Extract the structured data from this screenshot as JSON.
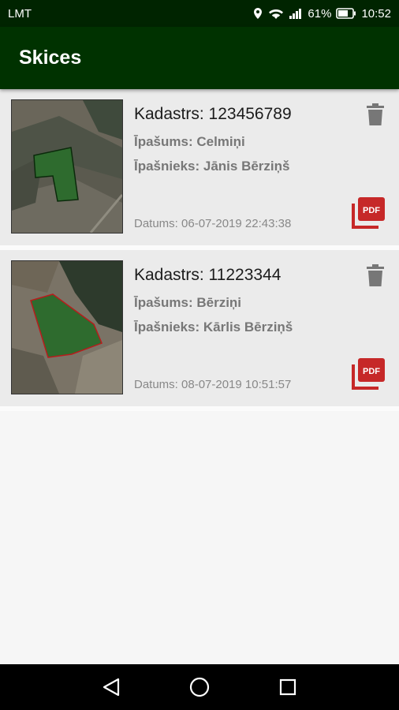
{
  "status_bar": {
    "carrier": "LMT",
    "battery": "61%",
    "time": "10:52"
  },
  "app_bar": {
    "title": "Skices"
  },
  "sketches": [
    {
      "title": "Kadastrs: 123456789",
      "property": "Īpašums: Celmiņi",
      "owner": "Īpašnieks: Jānis Bērziņš",
      "date": "Datums: 06-07-2019 22:43:38"
    },
    {
      "title": "Kadastrs: 11223344",
      "property": "Īpašums: Bērziņi",
      "owner": "Īpašnieks: Kārlis Bērziņš",
      "date": "Datums: 08-07-2019 10:51:57"
    }
  ],
  "icons": {
    "delete": "trash-icon",
    "pdf": "pdf-icon",
    "back": "back-triangle-icon",
    "home": "home-circle-icon",
    "recents": "recents-square-icon"
  },
  "colors": {
    "status_bar": "#002400",
    "app_bar": "#003200",
    "pdf_red": "#c62828",
    "polygon_fill": "#2e6b2e"
  }
}
